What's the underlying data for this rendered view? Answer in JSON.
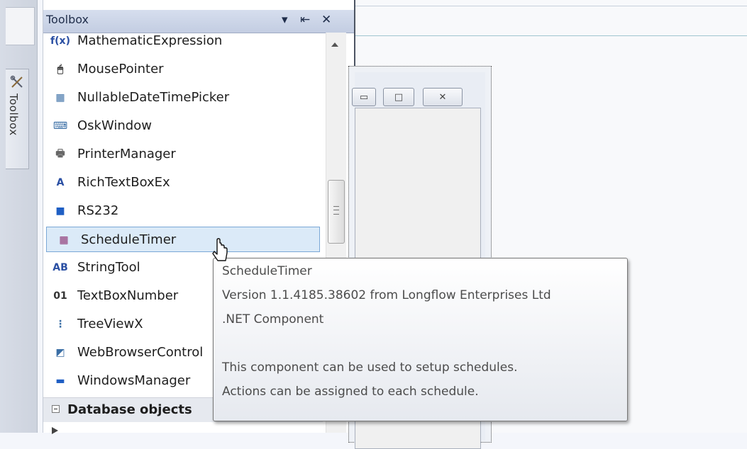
{
  "left_dock": {
    "toolbox_tab_label": "Toolbox",
    "icon": "tools-icon"
  },
  "toolbox": {
    "title": "Toolbox",
    "buttons": {
      "dropdown": "▾",
      "pin": "⇤",
      "close": "✕"
    },
    "items": [
      {
        "label": "MathematicExpression",
        "icon": "fx-icon",
        "icon_text": "f(x)",
        "color": "#2a4fa3"
      },
      {
        "label": "MousePointer",
        "icon": "mouse-icon",
        "icon_text": "🖱",
        "color": "#333333"
      },
      {
        "label": "NullableDateTimePicker",
        "icon": "calendar-icon",
        "icon_text": "▦",
        "color": "#3a6ea5"
      },
      {
        "label": "OskWindow",
        "icon": "keyboard-icon",
        "icon_text": "⌨",
        "color": "#3a6ea5"
      },
      {
        "label": "PrinterManager",
        "icon": "printer-icon",
        "icon_text": "🖶",
        "color": "#666666"
      },
      {
        "label": "RichTextBoxEx",
        "icon": "richtext-icon",
        "icon_text": "A",
        "color": "#2a4fa3"
      },
      {
        "label": "RS232",
        "icon": "port-icon",
        "icon_text": "■",
        "color": "#1f5fc4"
      },
      {
        "label": "ScheduleTimer",
        "icon": "schedule-icon",
        "icon_text": "▦",
        "color": "#8b2d6e",
        "selected": true
      },
      {
        "label": "StringTool",
        "icon": "string-tool-icon",
        "icon_text": "AB",
        "color": "#2a4fa3"
      },
      {
        "label": "TextBoxNumber",
        "icon": "number-box-icon",
        "icon_text": "01",
        "color": "#333333"
      },
      {
        "label": "TreeViewX",
        "icon": "tree-icon",
        "icon_text": "⋮",
        "color": "#3a6ea5"
      },
      {
        "label": "WebBrowserControl",
        "icon": "browser-icon",
        "icon_text": "◩",
        "color": "#3a6ea5"
      },
      {
        "label": "WindowsManager",
        "icon": "windows-icon",
        "icon_text": "▬",
        "color": "#1f5fc4"
      }
    ],
    "group": {
      "label": "Database objects"
    }
  },
  "tooltip": {
    "lines": [
      "ScheduleTimer",
      "Version 1.1.4185.38602 from Longflow Enterprises Ltd",
      ".NET Component",
      "",
      "This component can be used to setup schedules.",
      "Actions can be assigned to each schedule."
    ]
  },
  "designer": {
    "caption_buttons": [
      {
        "name": "minimize",
        "glyph": "▭"
      },
      {
        "name": "maximize",
        "glyph": "□"
      },
      {
        "name": "close",
        "glyph": "✕"
      }
    ]
  },
  "colors": {
    "accent": "#7aa7d6",
    "selection": "#dbeaf8",
    "titlebar": "#c3cde2"
  }
}
